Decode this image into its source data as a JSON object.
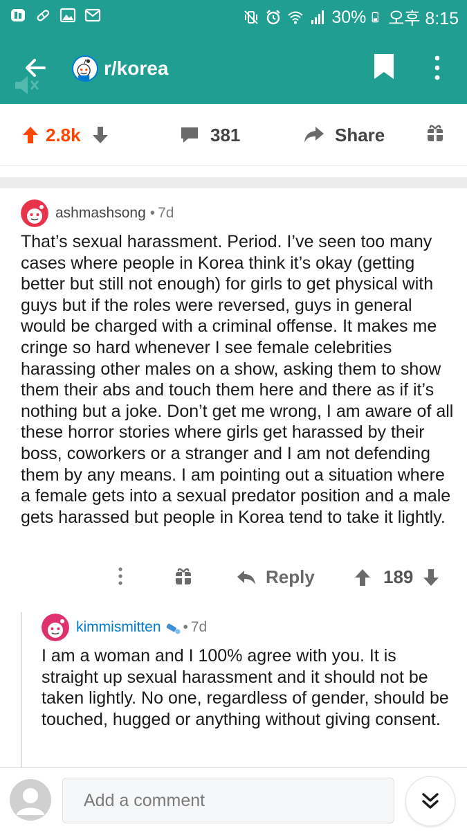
{
  "status_bar": {
    "battery": "30%",
    "time": "오후 8:15"
  },
  "header": {
    "subreddit": "r/korea"
  },
  "post_actions": {
    "votes": "2.8k",
    "comments": "381",
    "share": "Share"
  },
  "comments": [
    {
      "author": "ashmashsong",
      "separator": "•",
      "age": "7d",
      "body": "That’s sexual harassment. Period. I’ve seen too many cases where people in Korea think it’s okay (getting better but still not enough) for girls to get physical with guys but if the roles were reversed, guys in general would be charged with a criminal offense. It makes me cringe so hard whenever I see female celebrities harassing other males on a show, asking them to show them their abs and touch them here and there as if it’s nothing but a joke. Don’t get me wrong, I am aware of all these horror stories where girls get harassed by their boss, coworkers or a stranger and I am not defending them by any means. I am pointing out a situation where a female gets into a sexual predator position and a male gets harassed but people in Korea tend to take it lightly.",
      "reply": "Reply",
      "score": "189"
    },
    {
      "author": "kimmismitten",
      "separator": "•",
      "age": "7d",
      "body": "I am a woman and I 100% agree with you. It is straight up sexual harassment and it should not be taken lightly. No one, regardless of gender, should be touched, hugged or anything without giving consent."
    }
  ],
  "composer": {
    "placeholder": "Add a comment"
  },
  "colors": {
    "header_bg": "#1f9e91",
    "upvote": "#ff4500",
    "link_blue": "#0079d3"
  }
}
